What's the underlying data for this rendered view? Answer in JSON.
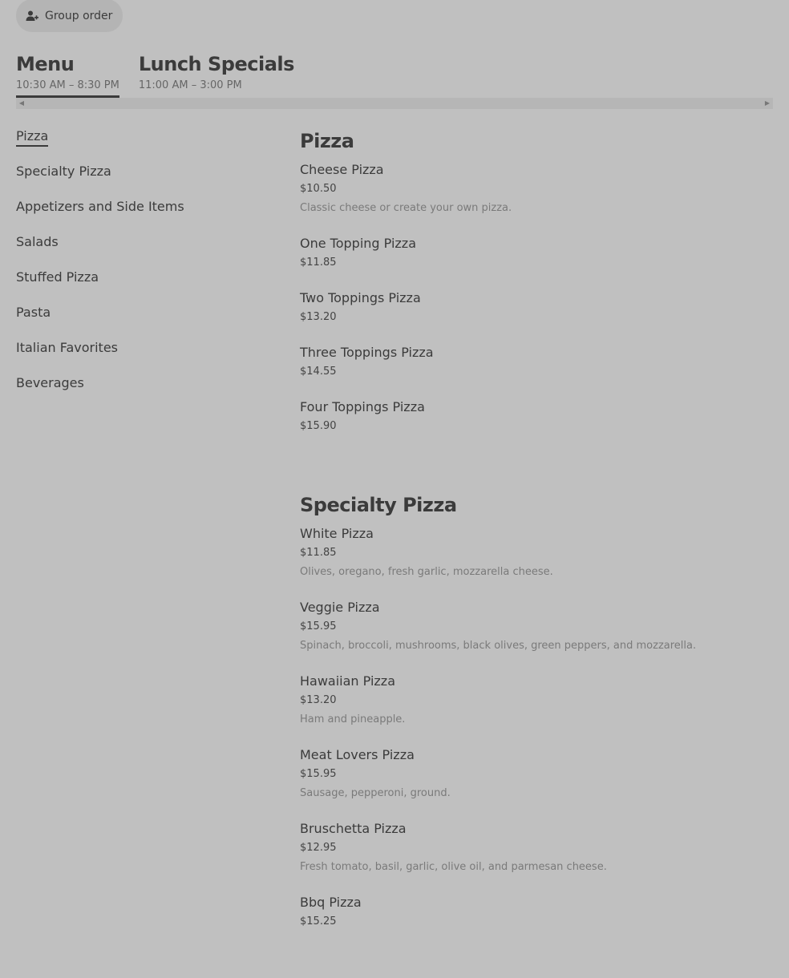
{
  "header": {
    "group_order_label": "Group order"
  },
  "tabs": [
    {
      "title": "Menu",
      "hours": "10:30 AM – 8:30 PM"
    },
    {
      "title": "Lunch Specials",
      "hours": "11:00 AM – 3:00 PM"
    }
  ],
  "sidebar": {
    "items": [
      {
        "label": "Pizza"
      },
      {
        "label": "Specialty Pizza"
      },
      {
        "label": "Appetizers and Side Items"
      },
      {
        "label": "Salads"
      },
      {
        "label": "Stuffed Pizza"
      },
      {
        "label": "Pasta"
      },
      {
        "label": "Italian Favorites"
      },
      {
        "label": "Beverages"
      }
    ]
  },
  "sections": [
    {
      "title": "Pizza",
      "items": [
        {
          "name": "Cheese Pizza",
          "price": "$10.50",
          "desc": "Classic cheese or create your own pizza."
        },
        {
          "name": "One Topping Pizza",
          "price": "$11.85",
          "desc": ""
        },
        {
          "name": "Two Toppings Pizza",
          "price": "$13.20",
          "desc": ""
        },
        {
          "name": "Three Toppings Pizza",
          "price": "$14.55",
          "desc": ""
        },
        {
          "name": "Four Toppings Pizza",
          "price": "$15.90",
          "desc": ""
        }
      ]
    },
    {
      "title": "Specialty Pizza",
      "items": [
        {
          "name": "White Pizza",
          "price": "$11.85",
          "desc": "Olives, oregano, fresh garlic, mozzarella cheese."
        },
        {
          "name": "Veggie Pizza",
          "price": "$15.95",
          "desc": "Spinach, broccoli, mushrooms, black olives, green peppers, and mozzarella."
        },
        {
          "name": "Hawaiian Pizza",
          "price": "$13.20",
          "desc": "Ham and pineapple."
        },
        {
          "name": "Meat Lovers Pizza",
          "price": "$15.95",
          "desc": "Sausage, pepperoni, ground."
        },
        {
          "name": "Bruschetta Pizza",
          "price": "$12.95",
          "desc": "Fresh tomato, basil, garlic, olive oil, and parmesan cheese."
        },
        {
          "name": "Bbq Pizza",
          "price": "$15.25",
          "desc": ""
        }
      ]
    }
  ]
}
